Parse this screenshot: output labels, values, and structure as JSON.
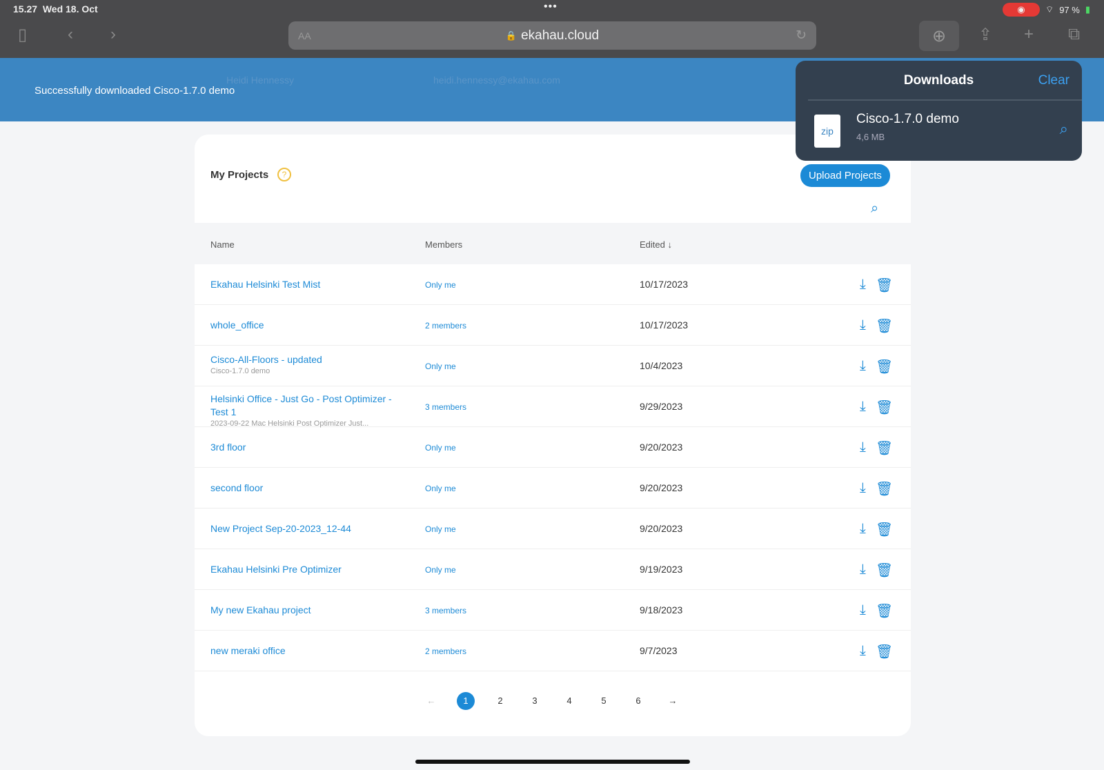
{
  "status": {
    "time": "15.27",
    "date": "Wed 18. Oct",
    "battery": "97 %"
  },
  "browser": {
    "url": "ekahau.cloud",
    "aa": "AA"
  },
  "banner": {
    "message": "Successfully downloaded Cisco-1.7.0 demo",
    "ghost_name": "Heidi Hennessy",
    "ghost_email": "heidi.hennessy@ekahau.com"
  },
  "projects": {
    "title": "My Projects",
    "help": "?",
    "upload": "Upload Projects",
    "columns": {
      "name": "Name",
      "members": "Members",
      "edited": "Edited ↓"
    },
    "rows": [
      {
        "name": "Ekahau Helsinki Test Mist",
        "sub": "",
        "members": "Only me",
        "edited": "10/17/2023"
      },
      {
        "name": "whole_office",
        "sub": "",
        "members": "2 members",
        "edited": "10/17/2023"
      },
      {
        "name": "Cisco-All-Floors - updated",
        "sub": "Cisco-1.7.0 demo",
        "members": "Only me",
        "edited": "10/4/2023"
      },
      {
        "name": "Helsinki Office - Just Go - Post Optimizer - Test 1",
        "sub": "2023-09-22 Mac Helsinki Post Optimizer Just...",
        "members": "3 members",
        "edited": "9/29/2023"
      },
      {
        "name": "3rd floor",
        "sub": "",
        "members": "Only me",
        "edited": "9/20/2023"
      },
      {
        "name": "second floor",
        "sub": "",
        "members": "Only me",
        "edited": "9/20/2023"
      },
      {
        "name": "New Project Sep-20-2023_12-44",
        "sub": "",
        "members": "Only me",
        "edited": "9/20/2023"
      },
      {
        "name": "Ekahau Helsinki Pre Optimizer",
        "sub": "",
        "members": "Only me",
        "edited": "9/19/2023"
      },
      {
        "name": "My new Ekahau project",
        "sub": "",
        "members": "3 members",
        "edited": "9/18/2023"
      },
      {
        "name": "new meraki office",
        "sub": "",
        "members": "2 members",
        "edited": "9/7/2023"
      }
    ],
    "pages": [
      "1",
      "2",
      "3",
      "4",
      "5",
      "6"
    ],
    "current_page": "1"
  },
  "downloads": {
    "title": "Downloads",
    "clear": "Clear",
    "file": "Cisco-1.7.0 demo",
    "size": "4,6 MB",
    "type": "zip"
  }
}
